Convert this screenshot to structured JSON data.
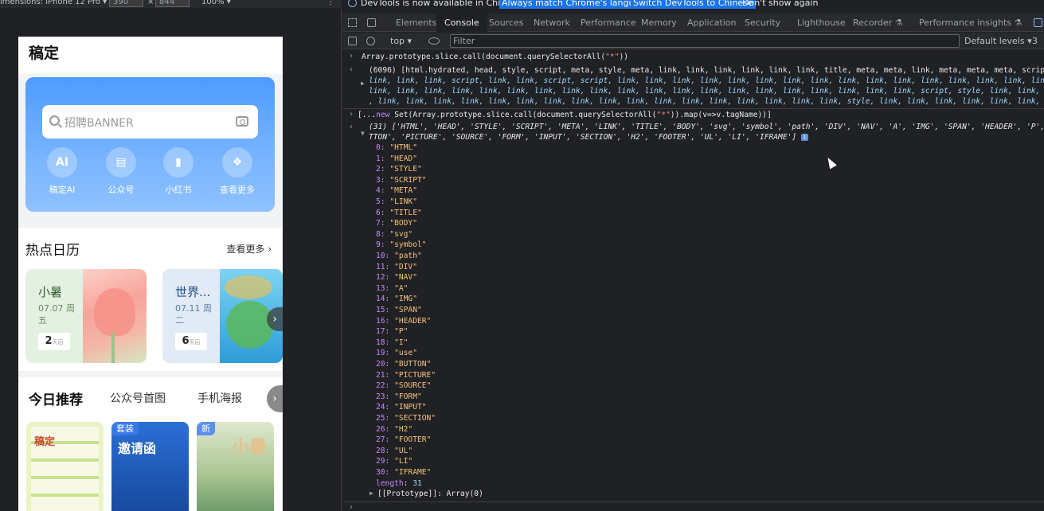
{
  "device_toolbar": {
    "dimensions_label": "imensions: iPhone 12 Pro ▾",
    "width": "390",
    "times": "×",
    "height": "844",
    "zoom": "100% ▾",
    "more": "⋮"
  },
  "phone": {
    "title": "稿定",
    "search_placeholder": "招聘BANNER",
    "quick_items": [
      {
        "label": "稿定AI",
        "glyph": "AI"
      },
      {
        "label": "公众号",
        "glyph": "▤"
      },
      {
        "label": "小红书",
        "glyph": "▮"
      },
      {
        "label": "查看更多",
        "glyph": "❖"
      }
    ],
    "hot": {
      "title": "热点日历",
      "more": "查看更多 ›",
      "cards": [
        {
          "name": "小暑",
          "date": "07.07 周五",
          "days": "2",
          "unit": "天后"
        },
        {
          "name": "世界...",
          "date": "07.11 周二",
          "days": "6",
          "unit": "天后"
        }
      ],
      "next": "›"
    },
    "recommend": {
      "tabs": [
        "今日推荐",
        "公众号首图",
        "手机海报"
      ],
      "next": "›",
      "posters": [
        {
          "tag": "",
          "text": "稿定"
        },
        {
          "tag": "套装",
          "text": "邀请函"
        },
        {
          "tag": "新",
          "text": "小暑"
        }
      ]
    }
  },
  "devtools": {
    "infobar": {
      "message": "DevTools is now available in Chinese!",
      "btn_match": "Always match Chrome's language",
      "btn_switch": "Switch DevTools to Chinese",
      "dismiss": "Don't show again"
    },
    "tabs": [
      "Elements",
      "Console",
      "Sources",
      "Network",
      "Performance",
      "Memory",
      "Application",
      "Security",
      "Lighthouse",
      "Recorder ⚗",
      "Performance insights ⚗"
    ],
    "active_tab": "Console",
    "console_bar": {
      "context": "top ▾",
      "filter_placeholder": "Filter",
      "levels": "Default levels ▾",
      "issues": "3"
    },
    "console": {
      "cmd1": {
        "obj": "Array",
        "rest": ".prototype.slice.call(document.querySelectorAll(",
        "str": "\"*\"",
        "end": "))"
      },
      "out1": [
        "(6096) [html.hydrated, head, style, script, meta, style, meta, link, link, link, link, link, link, title, meta, meta, link, meta, meta, meta, script, l",
        "link, link, link, script, link, link, script, script, link, link, link, link, link, link, link, link, link, link, link, link, link, link, link, link,",
        "link, link, link, link, link, link, link, link, link, link, link, link, link, link, link, link, link, link, link, link, script, style, link, link, link",
        ", link, link, link, link, link, link, link, link, link, link, link, link, link, link, link, link, link, style, link, link, link, link, link, link, …]"
      ],
      "cmd2": {
        "pre": "[...",
        "kw": "new",
        "rest": " Set(Array.prototype.slice.call(document.querySelectorAll(",
        "str": "\"*\"",
        "end": ")).map(v=>v.tagName))]"
      },
      "out2_head": [
        "(31) ['HTML', 'HEAD', 'STYLE', 'SCRIPT', 'META', 'LINK', 'TITLE', 'BODY', 'svg', 'symbol', 'path', 'DIV', 'NAV', 'A', 'IMG', 'SPAN', 'HEADER', 'P', 'I'",
        "TTON', 'PICTURE', 'SOURCE', 'FORM', 'INPUT', 'SECTION', 'H2', 'FOOTER', 'UL', 'LI', 'IFRAME']"
      ],
      "entries": [
        "HTML",
        "HEAD",
        "STYLE",
        "SCRIPT",
        "META",
        "LINK",
        "TITLE",
        "BODY",
        "svg",
        "symbol",
        "path",
        "DIV",
        "NAV",
        "A",
        "IMG",
        "SPAN",
        "HEADER",
        "P",
        "I",
        "use",
        "BUTTON",
        "PICTURE",
        "SOURCE",
        "FORM",
        "INPUT",
        "SECTION",
        "H2",
        "FOOTER",
        "UL",
        "LI",
        "IFRAME"
      ],
      "length_label": "length",
      "length_value": "31",
      "prototype": "[[Prototype]]: Array(0)",
      "info_badge": "i"
    }
  },
  "colors": {
    "banner": "#4c9cff",
    "devtools_bg": "#202124",
    "accent": "#1a73e8"
  }
}
